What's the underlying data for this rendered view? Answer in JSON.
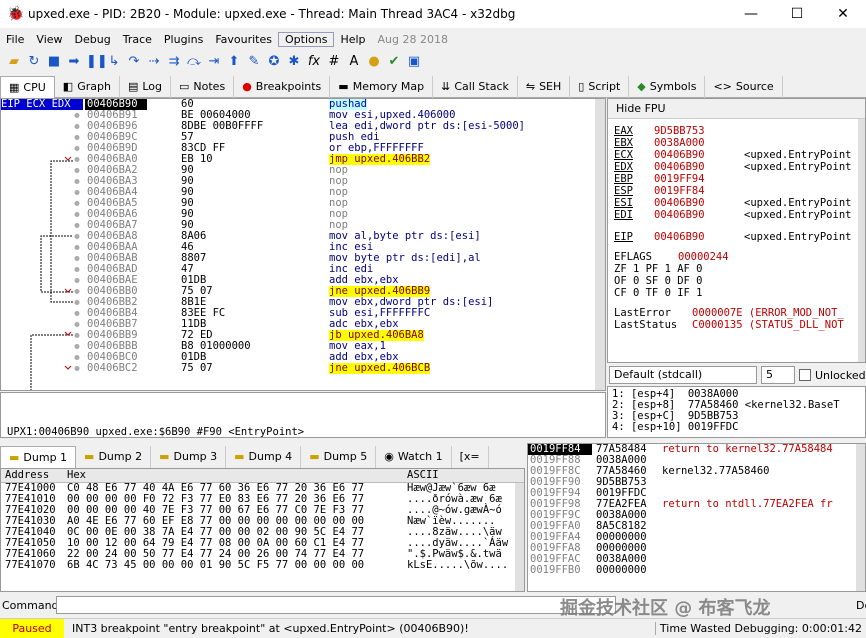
{
  "window": {
    "title": "upxed.exe - PID: 2B20 - Module: upxed.exe - Thread: Main Thread 3AC4 - x32dbg"
  },
  "menu": [
    "File",
    "View",
    "Debug",
    "Trace",
    "Plugins",
    "Favourites",
    "Options",
    "Help",
    "Aug 28 2018"
  ],
  "tabs": [
    "CPU",
    "Graph",
    "Log",
    "Notes",
    "Breakpoints",
    "Memory Map",
    "Call Stack",
    "SEH",
    "Script",
    "Symbols",
    "Source"
  ],
  "cpu": {
    "header": "EIP ECX EDX",
    "rows": [
      {
        "a": "00406B90",
        "b": "60",
        "i": "pushad",
        "cur": true
      },
      {
        "a": "00406B91",
        "b": "BE 00604000",
        "i": "mov esi,upxed.406000"
      },
      {
        "a": "00406B96",
        "b": "8DBE 00B0FFFF",
        "i": "lea edi,dword ptr ds:[esi-5000]"
      },
      {
        "a": "00406B9C",
        "b": "57",
        "i": "push edi"
      },
      {
        "a": "00406B9D",
        "b": "83CD FF",
        "i": "or ebp,FFFFFFFF"
      },
      {
        "a": "00406BA0",
        "b": "EB 10",
        "i": "jmp upxed.406BB2",
        "j": true
      },
      {
        "a": "00406BA2",
        "b": "90",
        "i": "nop",
        "n": true
      },
      {
        "a": "00406BA3",
        "b": "90",
        "i": "nop",
        "n": true
      },
      {
        "a": "00406BA4",
        "b": "90",
        "i": "nop",
        "n": true
      },
      {
        "a": "00406BA5",
        "b": "90",
        "i": "nop",
        "n": true
      },
      {
        "a": "00406BA6",
        "b": "90",
        "i": "nop",
        "n": true
      },
      {
        "a": "00406BA7",
        "b": "90",
        "i": "nop",
        "n": true
      },
      {
        "a": "00406BA8",
        "b": "8A06",
        "i": "mov al,byte ptr ds:[esi]"
      },
      {
        "a": "00406BAA",
        "b": "46",
        "i": "inc esi"
      },
      {
        "a": "00406BAB",
        "b": "8807",
        "i": "mov byte ptr ds:[edi],al"
      },
      {
        "a": "00406BAD",
        "b": "47",
        "i": "inc edi"
      },
      {
        "a": "00406BAE",
        "b": "01DB",
        "i": "add ebx,ebx"
      },
      {
        "a": "00406BB0",
        "b": "75 07",
        "i": "jne upxed.406BB9",
        "j": true
      },
      {
        "a": "00406BB2",
        "b": "8B1E",
        "i": "mov ebx,dword ptr ds:[esi]"
      },
      {
        "a": "00406BB4",
        "b": "83EE FC",
        "i": "sub esi,FFFFFFFC"
      },
      {
        "a": "00406BB7",
        "b": "11DB",
        "i": "adc ebx,ebx"
      },
      {
        "a": "00406BB9",
        "b": "72 ED",
        "i": "jb upxed.406BA8",
        "j": true
      },
      {
        "a": "00406BBB",
        "b": "B8 01000000",
        "i": "mov eax,1"
      },
      {
        "a": "00406BC0",
        "b": "01DB",
        "i": "add ebx,ebx"
      },
      {
        "a": "00406BC2",
        "b": "75 07",
        "i": "jne upxed.406BCB",
        "j": true
      }
    ]
  },
  "regs": {
    "header": "Hide FPU",
    "list": [
      {
        "n": "EAX",
        "v": "9D5BB753",
        "c": ""
      },
      {
        "n": "EBX",
        "v": "0038A000",
        "c": ""
      },
      {
        "n": "ECX",
        "v": "00406B90",
        "c": "<upxed.EntryPoint"
      },
      {
        "n": "EDX",
        "v": "00406B90",
        "c": "<upxed.EntryPoint"
      },
      {
        "n": "EBP",
        "v": "0019FF94",
        "c": ""
      },
      {
        "n": "ESP",
        "v": "0019FF84",
        "c": ""
      },
      {
        "n": "ESI",
        "v": "00406B90",
        "c": "<upxed.EntryPoint"
      },
      {
        "n": "EDI",
        "v": "00406B90",
        "c": "<upxed.EntryPoint"
      },
      {
        "n": "",
        "v": "",
        "c": ""
      },
      {
        "n": "EIP",
        "v": "00406B90",
        "c": "<upxed.EntryPoint"
      }
    ],
    "eflags_label": "EFLAGS",
    "eflags": "00000244",
    "flags": [
      "ZF 1  PF 1  AF 0",
      "OF 0  SF 0  DF 0",
      "CF 0  TF 0  IF 1"
    ],
    "lasterror_label": "LastError",
    "lasterror": "0000007E (ERROR_MOD_NOT_",
    "laststatus_label": "LastStatus",
    "laststatus": "C0000135 (STATUS_DLL_NOT"
  },
  "callconv": {
    "value": "Default (stdcall)",
    "argc": "5",
    "unlocked": "Unlocked"
  },
  "stackargs": "1: [esp+4]  0038A000\n2: [esp+8]  77A58460 <kernel32.BaseT\n3: [esp+C]  9D5BB753\n4: [esp+10] 0019FFDC",
  "info": "UPX1:00406B90 upxed.exe:$6B90 #F90 <EntryPoint>",
  "dumptabs": [
    "Dump 1",
    "Dump 2",
    "Dump 3",
    "Dump 4",
    "Dump 5",
    "Watch 1",
    "[x="
  ],
  "dump": {
    "h_addr": "Address",
    "h_hex": "Hex",
    "h_ascii": "ASCII",
    "rows": [
      {
        "a": "77E41000",
        "h": "C0 48 E6 77  40 4A E6 77  60 36 E6 77  20 36 E6 77",
        "s": "Hæw@Jæw`6æw 6æ"
      },
      {
        "a": "77E41010",
        "h": "00 00 00 00  F0 72 F3 77  E0 83 E6 77  20 36 E6 77",
        "s": "....ðrówà.æw 6æ"
      },
      {
        "a": "77E41020",
        "h": "00 00 00 00  40 7E F3 77  00 67 E6 77  C0 7E F3 77",
        "s": "....@~ów.gæwÀ~ó"
      },
      {
        "a": "77E41030",
        "h": "A0 4E E6 77  60 EF E8 77  00 00 00 00  00 00 00 00",
        "s": " Næw`ïèw......."
      },
      {
        "a": "77E41040",
        "h": "0C 00 0E 00  38 7A E4 77  00 00 02 00  90 5C E4 77",
        "s": "....8zäw....\\äw"
      },
      {
        "a": "77E41050",
        "h": "10 00 12 00  64 79 E4 77  08 00 0A 00  60 C1 E4 77",
        "s": "....dyäw....`Áäw"
      },
      {
        "a": "77E41060",
        "h": "22 00 24 00  50 77 E4 77  24 00 26 00  74 77 E4 77",
        "s": "\".$.Pwäw$.&.twä"
      },
      {
        "a": "77E41070",
        "h": "6B 4C 73 45  00 00 00 01  90 5C F5 77  00 00 00 00",
        "s": "kLsE.....\\õw...."
      }
    ]
  },
  "stack": [
    {
      "a": "0019FF84",
      "v": "77A58484",
      "c": "return to kernel32.77A58484",
      "cur": true
    },
    {
      "a": "0019FF88",
      "v": "0038A000",
      "c": ""
    },
    {
      "a": "0019FF8C",
      "v": "77A58460",
      "c": "kernel32.77A58460",
      "plain": true
    },
    {
      "a": "0019FF90",
      "v": "9D5BB753",
      "c": ""
    },
    {
      "a": "0019FF94",
      "v": "0019FFDC",
      "c": ""
    },
    {
      "a": "0019FF98",
      "v": "77EA2FEA",
      "c": "return to ntdll.77EA2FEA fr"
    },
    {
      "a": "0019FF9C",
      "v": "0038A000",
      "c": ""
    },
    {
      "a": "0019FFA0",
      "v": "8A5C8182",
      "c": ""
    },
    {
      "a": "0019FFA4",
      "v": "00000000",
      "c": ""
    },
    {
      "a": "0019FFA8",
      "v": "00000000",
      "c": ""
    },
    {
      "a": "0019FFAC",
      "v": "0038A000",
      "c": ""
    },
    {
      "a": "0019FFB0",
      "v": "00000000",
      "c": ""
    }
  ],
  "cmd": {
    "label": "Command:",
    "default": "Default"
  },
  "status": {
    "paused": "Paused",
    "msg": "INT3 breakpoint \"entry breakpoint\" at <upxed.EntryPoint> (00406B90)!",
    "time": "Time Wasted Debugging: 0:00:01:42"
  },
  "watermark": "掘金技术社区 @ 布客飞龙"
}
